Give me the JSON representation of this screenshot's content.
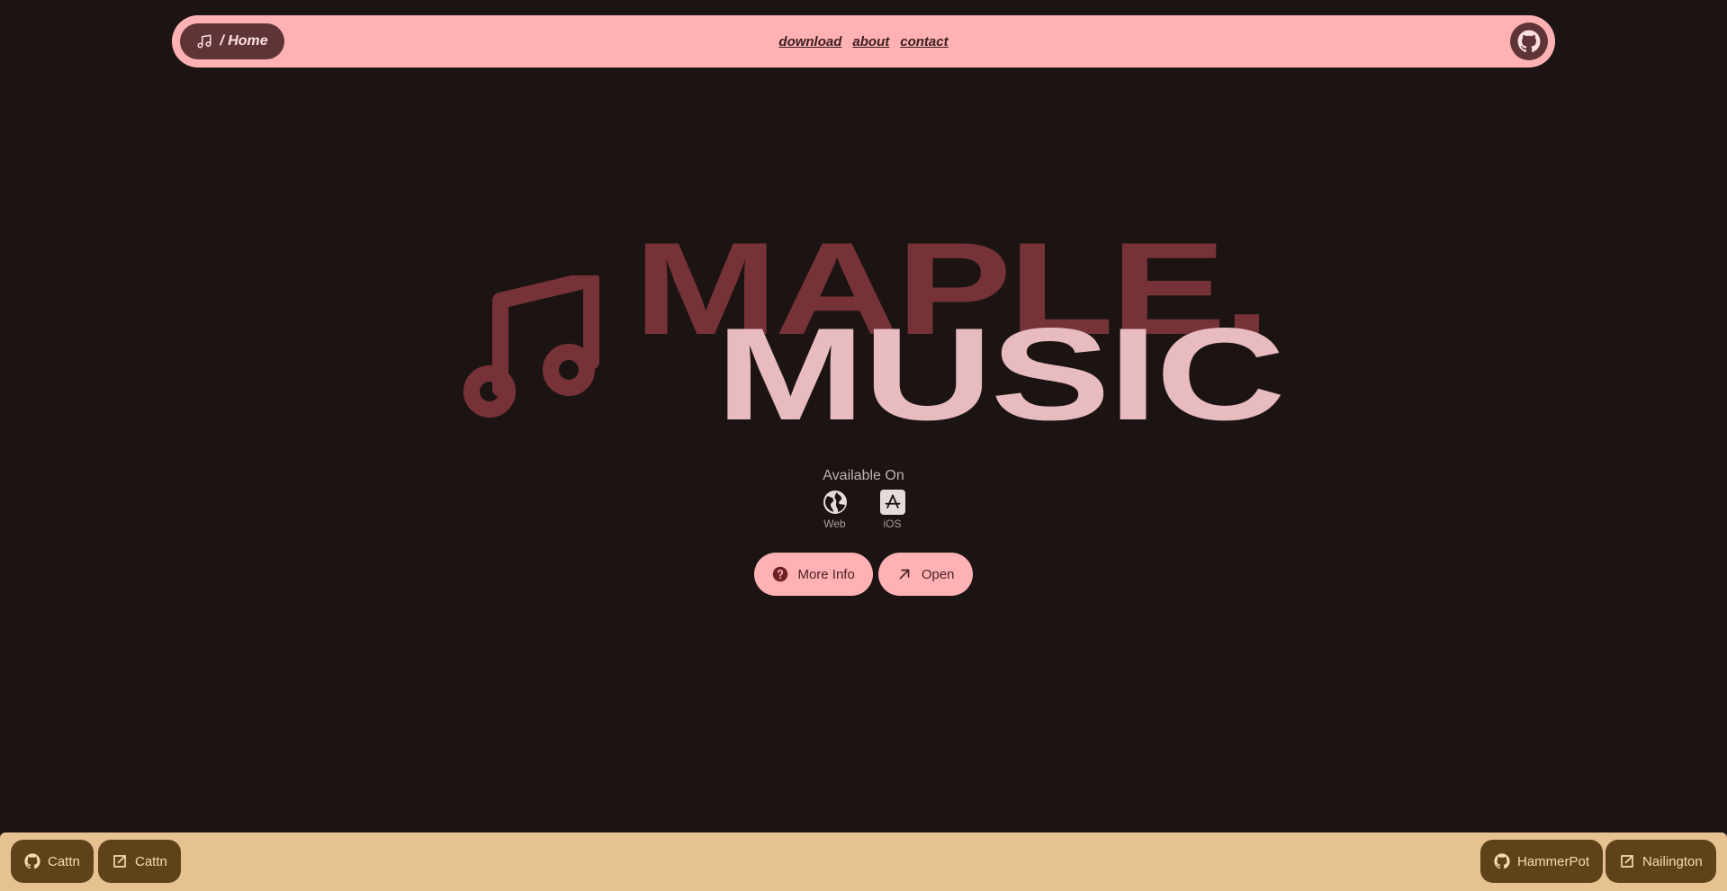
{
  "nav": {
    "home_label": "/ Home",
    "home_icon": "music-note-icon",
    "links": [
      "download",
      "about",
      "contact"
    ],
    "github_icon": "github-icon"
  },
  "hero": {
    "title_line1": "MAPLE.",
    "title_line2": "MUSIC",
    "logo_icon": "music-note-icon"
  },
  "available": {
    "title": "Available On",
    "platforms": [
      {
        "label": "Web",
        "icon": "globe-icon"
      },
      {
        "label": "iOS",
        "icon": "app-store-icon"
      }
    ]
  },
  "actions": {
    "more_info": "More Info",
    "open": "Open"
  },
  "footer": {
    "left": [
      {
        "label": "Cattn",
        "icon": "github-icon"
      },
      {
        "label": "Cattn",
        "icon": "external-link-icon"
      }
    ],
    "right": [
      {
        "label": "HammerPot",
        "icon": "github-icon"
      },
      {
        "label": "Nailington",
        "icon": "external-link-icon"
      }
    ]
  },
  "colors": {
    "background": "#1c1413",
    "nav_pink": "#ffb1b4",
    "maple_red": "#763237",
    "music_pink": "#e7bbbf",
    "footer_tan": "#e7c291",
    "footer_button": "#5e4219"
  }
}
